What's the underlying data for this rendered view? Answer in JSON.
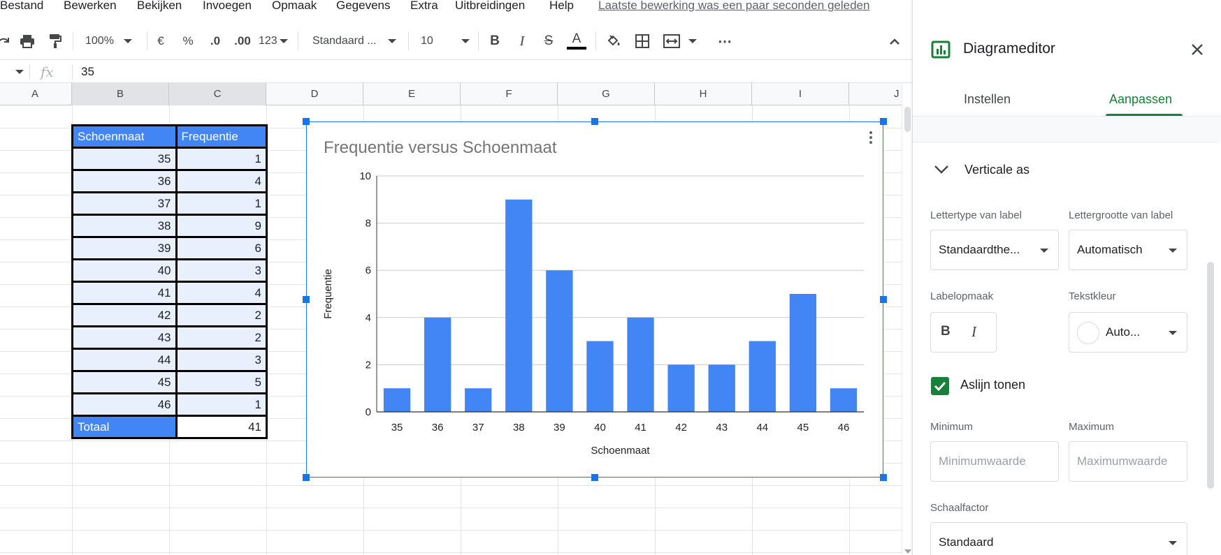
{
  "menu": {
    "items": [
      "Bestand",
      "Bewerken",
      "Bekijken",
      "Invoegen",
      "Opmaak",
      "Gegevens",
      "Extra",
      "Uitbreidingen",
      "Help"
    ],
    "last_edit": "Laatste bewerking was een paar seconden geleden"
  },
  "toolbar": {
    "zoom": "100%",
    "currency": "€",
    "percent": "%",
    "decrease_decimals": ".0",
    "increase_decimals": ".00",
    "number_format": "123",
    "font": "Standaard ...",
    "font_size": "10",
    "bold": "B",
    "italic": "I",
    "strikethrough": "S",
    "text_color": "A",
    "more": "⋯"
  },
  "formula_bar": {
    "fx": "fx",
    "value": "35"
  },
  "columns": [
    "A",
    "B",
    "C",
    "D",
    "E",
    "F",
    "G",
    "H",
    "I",
    "J"
  ],
  "table": {
    "headers": [
      "Schoenmaat",
      "Frequentie"
    ],
    "rows": [
      [
        "35",
        "1"
      ],
      [
        "36",
        "4"
      ],
      [
        "37",
        "1"
      ],
      [
        "38",
        "9"
      ],
      [
        "39",
        "6"
      ],
      [
        "40",
        "3"
      ],
      [
        "41",
        "4"
      ],
      [
        "42",
        "2"
      ],
      [
        "43",
        "2"
      ],
      [
        "44",
        "3"
      ],
      [
        "45",
        "5"
      ],
      [
        "46",
        "1"
      ]
    ],
    "total_label": "Totaal",
    "total_value": "41"
  },
  "chart_data": {
    "type": "bar",
    "title": "Frequentie versus Schoenmaat",
    "xlabel": "Schoenmaat",
    "ylabel": "Frequentie",
    "categories": [
      "35",
      "36",
      "37",
      "38",
      "39",
      "40",
      "41",
      "42",
      "43",
      "44",
      "45",
      "46"
    ],
    "values": [
      1,
      4,
      1,
      9,
      6,
      3,
      4,
      2,
      2,
      3,
      5,
      1
    ],
    "ylim": [
      0,
      10
    ],
    "yticks": [
      0,
      2,
      4,
      6,
      8,
      10
    ],
    "grid": true,
    "bar_color": "#4285f4"
  },
  "panel": {
    "title": "Diagrameditor",
    "tabs": [
      "Instellen",
      "Aanpassen"
    ],
    "active_tab": "Aanpassen",
    "section_title": "Verticale as",
    "font_label": "Lettertype van label",
    "font_value": "Standaardthe...",
    "font_size_label": "Lettergrootte van label",
    "font_size_value": "Automatisch",
    "label_format_label": "Labelopmaak",
    "bold": "B",
    "italic": "I",
    "text_color_label": "Tekstkleur",
    "text_color_value": "Auto...",
    "show_axis_line": "Aslijn tonen",
    "show_axis_line_checked": true,
    "min_label": "Minimum",
    "min_placeholder": "Minimumwaarde",
    "max_label": "Maximum",
    "max_placeholder": "Maximumwaarde",
    "scale_label": "Schaalfactor",
    "scale_value": "Standaard",
    "accent_color": "#188038"
  }
}
